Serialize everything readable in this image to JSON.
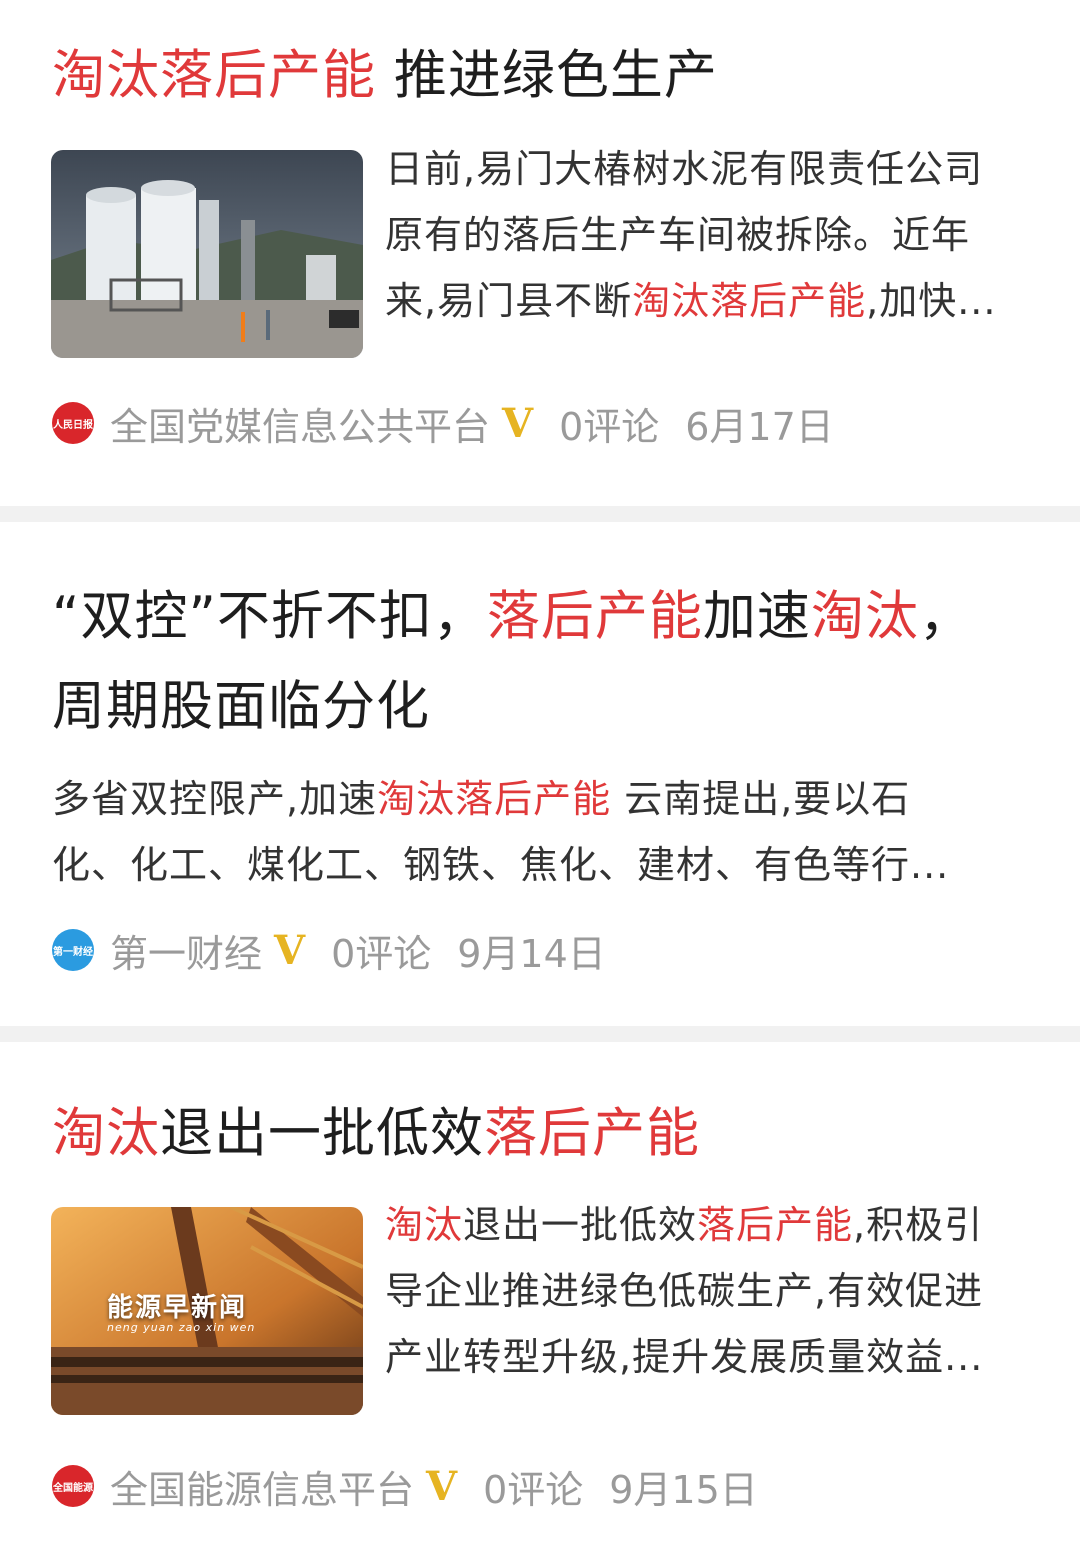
{
  "articles": [
    {
      "title_line": [
        {
          "text": "淘汰落后产能",
          "hl": true
        },
        {
          "text": " 推进绿色生产",
          "hl": false
        }
      ],
      "summary_lines": [
        [
          {
            "text": "日前,易门大椿树水泥有限责任公司",
            "hl": false
          }
        ],
        [
          {
            "text": "原有的落后生产车间被拆除。近年",
            "hl": false
          }
        ],
        [
          {
            "text": "来,易门县不断",
            "hl": false
          },
          {
            "text": "淘汰落后产能",
            "hl": true
          },
          {
            "text": ",加快...",
            "hl": false
          }
        ]
      ],
      "source": "全国党媒信息公共平台",
      "logo_text": "人民日报",
      "logo_color": "#d9262b",
      "comments": "0评论",
      "date": "6月17日"
    },
    {
      "title_lines": [
        [
          {
            "text": "“双控”不折不扣，",
            "hl": false
          },
          {
            "text": "落后产能",
            "hl": true
          },
          {
            "text": "加速",
            "hl": false
          },
          {
            "text": "淘汰",
            "hl": true
          },
          {
            "text": "，",
            "hl": false
          }
        ],
        [
          {
            "text": "周期股面临分化",
            "hl": false
          }
        ]
      ],
      "summary_lines": [
        [
          {
            "text": "多省双控限产,加速",
            "hl": false
          },
          {
            "text": "淘汰落后产能",
            "hl": true
          },
          {
            "text": " 云南提出,要以石",
            "hl": false
          }
        ],
        [
          {
            "text": "化、化工、煤化工、钢铁、焦化、建材、有色等行...",
            "hl": false
          }
        ]
      ],
      "source": "第一财经",
      "logo_text": "第一财经",
      "logo_color": "#2b9be0",
      "comments": "0评论",
      "date": "9月14日"
    },
    {
      "title_line": [
        {
          "text": "淘汰",
          "hl": true
        },
        {
          "text": "退出一批低效",
          "hl": false
        },
        {
          "text": "落后产能",
          "hl": true
        }
      ],
      "summary_lines": [
        [
          {
            "text": "淘汰",
            "hl": true
          },
          {
            "text": "退出一批低效",
            "hl": false
          },
          {
            "text": "落后产能",
            "hl": true
          },
          {
            "text": ",积极引",
            "hl": false
          }
        ],
        [
          {
            "text": "导企业推进绿色低碳生产,有效促进",
            "hl": false
          }
        ],
        [
          {
            "text": "产业转型升级,提升发展质量效益...",
            "hl": false
          }
        ]
      ],
      "thumb_caption": "能源早新闻",
      "thumb_subcaption": "neng yuan zao xin wen",
      "source": "全国能源信息平台",
      "logo_text": "全国能源",
      "logo_color": "#d9262b",
      "comments": "0评论",
      "date": "9月15日"
    }
  ],
  "badge": "V",
  "colors": {
    "highlight": "#e0393a",
    "badge": "#e6b422",
    "meta": "#9a9a9a"
  }
}
